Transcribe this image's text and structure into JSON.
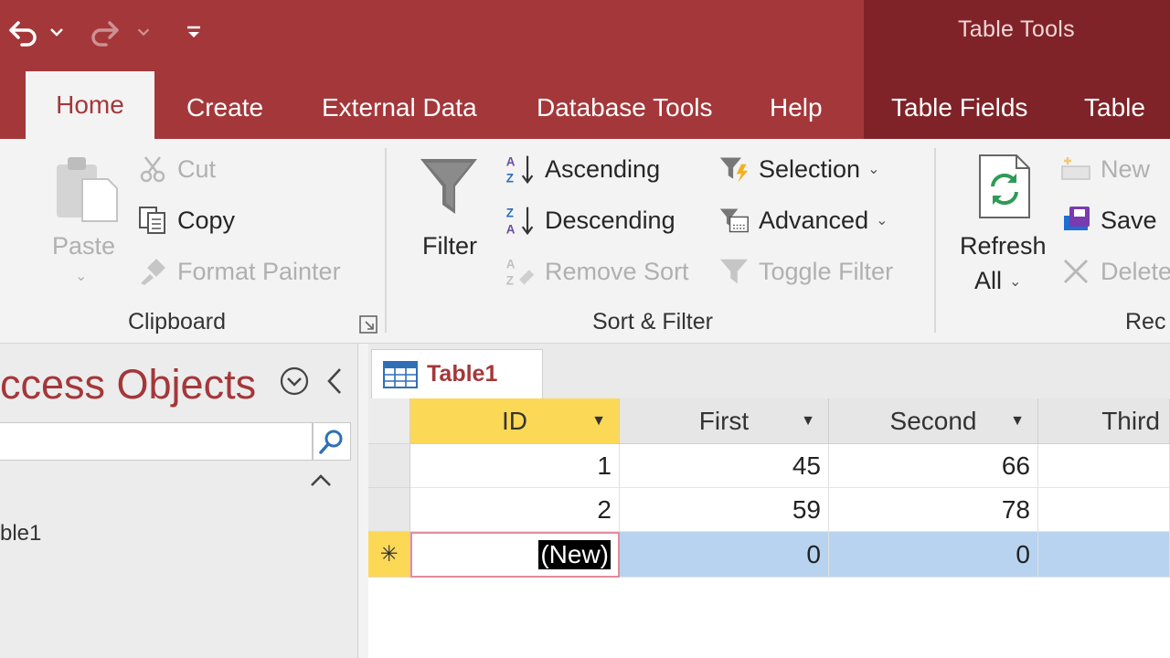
{
  "context_tab_group": "Table Tools",
  "tabs": {
    "home": "Home",
    "create": "Create",
    "external_data": "External Data",
    "database_tools": "Database Tools",
    "help": "Help",
    "table_fields": "Table Fields",
    "table": "Table"
  },
  "ribbon": {
    "clipboard": {
      "label": "Clipboard",
      "paste": "Paste",
      "cut": "Cut",
      "copy": "Copy",
      "format_painter": "Format Painter"
    },
    "sort_filter": {
      "label": "Sort & Filter",
      "filter": "Filter",
      "ascending": "Ascending",
      "descending": "Descending",
      "remove_sort": "Remove Sort",
      "selection": "Selection",
      "advanced": "Advanced",
      "toggle_filter": "Toggle Filter"
    },
    "records": {
      "label": "Rec",
      "refresh": "Refresh",
      "refresh_all": "All",
      "new": "New",
      "save": "Save",
      "delete": "Delete"
    }
  },
  "nav": {
    "title": "ccess Objects",
    "item": "ble1"
  },
  "doc": {
    "tab_label": "Table1",
    "columns": [
      "ID",
      "First",
      "Second",
      "Third"
    ],
    "rows": [
      {
        "id": "1",
        "first": "45",
        "second": "66"
      },
      {
        "id": "2",
        "first": "59",
        "second": "78"
      }
    ],
    "new_row": {
      "id": "(New)",
      "first": "0",
      "second": "0",
      "marker": "✳"
    }
  },
  "colors": {
    "accent": "#a4373a",
    "context": "#7f2328",
    "header_selected": "#fcd857",
    "new_row": "#b7d3ef"
  }
}
